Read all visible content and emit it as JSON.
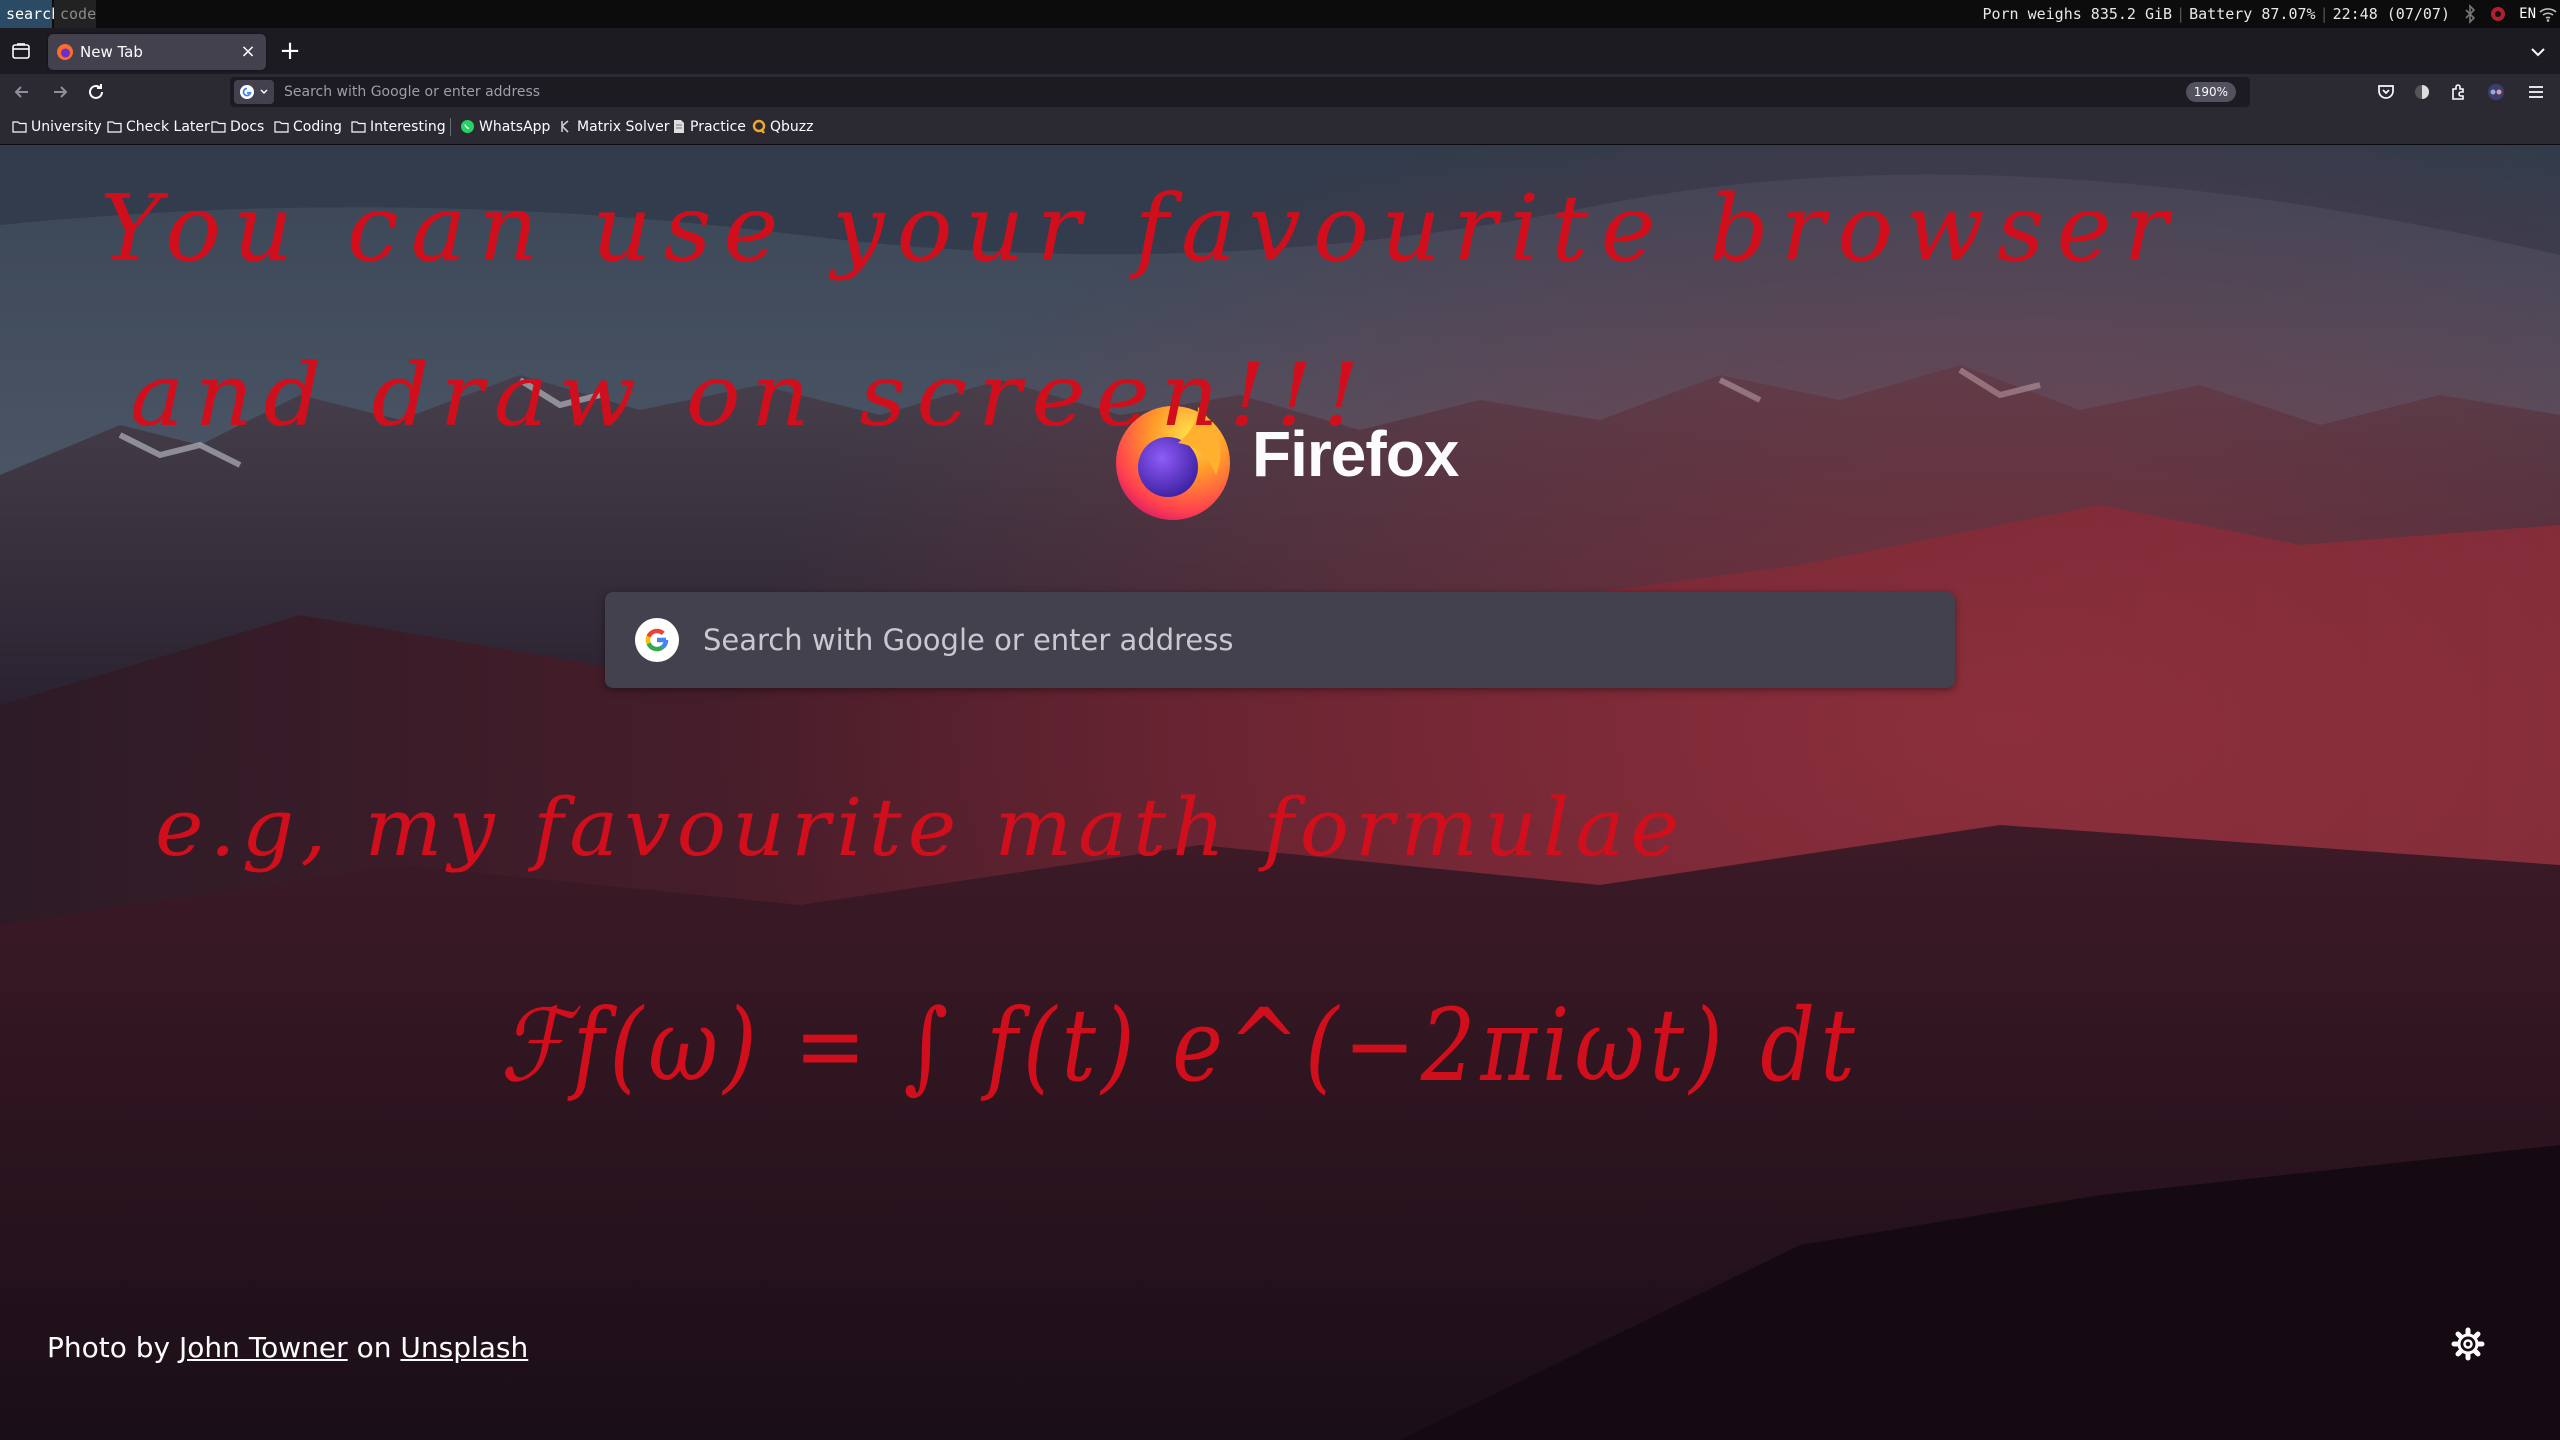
{
  "statusbar": {
    "workspaces": [
      "search",
      "code"
    ],
    "disk": "Porn weighs 835.2 GiB",
    "battery": "Battery 87.07%",
    "clock": "22:48 (07/07)",
    "lang": "EN"
  },
  "browser": {
    "tab_title": "New Tab",
    "urlbar_placeholder": "Search with Google or enter address",
    "zoom": "190%"
  },
  "bookmarks": [
    {
      "label": "University",
      "icon": "folder-icon"
    },
    {
      "label": "Check Later",
      "icon": "folder-icon"
    },
    {
      "label": "Docs",
      "icon": "folder-icon"
    },
    {
      "label": "Coding",
      "icon": "folder-icon"
    },
    {
      "label": "Interesting",
      "icon": "folder-icon"
    },
    {
      "label": "WhatsApp",
      "icon": "whatsapp-icon"
    },
    {
      "label": "Matrix Solver",
      "icon": "matrix-icon"
    },
    {
      "label": "Practice",
      "icon": "page-icon"
    },
    {
      "label": "Qbuzz",
      "icon": "qbuzz-icon"
    }
  ],
  "newtab": {
    "brand": "Firefox",
    "search_placeholder": "Search with Google or enter address",
    "attribution": {
      "prefix": "Photo by",
      "author": "John Towner",
      "middle": "on",
      "site": "Unsplash"
    }
  },
  "handwriting": {
    "line1": "You can use your favourite browser",
    "line2": "and draw on screen!!!",
    "line3": "e.g, my favourite math formulae",
    "formula": "ℱf(ω) = ∫ f(t) e^(−2πiωt) dt",
    "color": "#d10f1c"
  },
  "colors": {
    "accent": "#2b4a63",
    "toolbar": "#2b2a33",
    "tabstrip": "#1c1b22",
    "search_box": "#42414d"
  }
}
